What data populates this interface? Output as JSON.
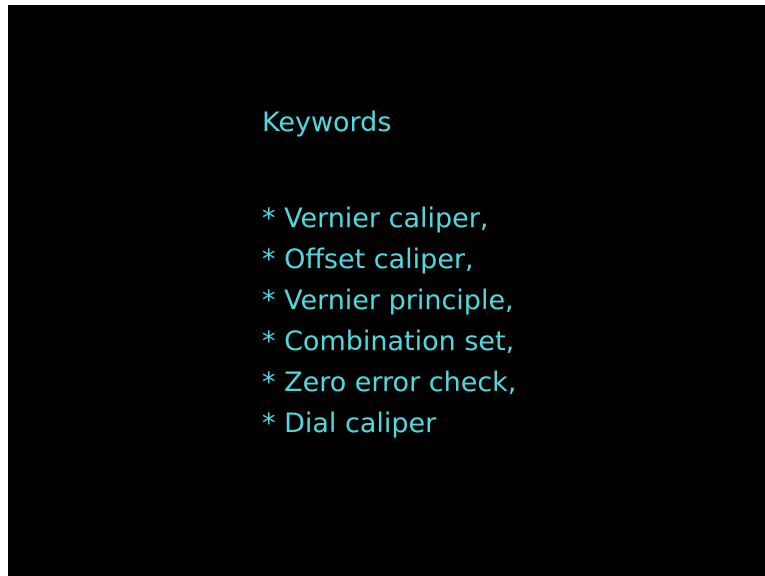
{
  "slide": {
    "title": "Keywords",
    "keywords": [
      "* Vernier caliper,",
      "* Offset caliper,",
      "* Vernier principle,",
      "* Combination set,",
      "* Zero error check,",
      "* Dial caliper"
    ],
    "colors": {
      "background": "#000000",
      "text": "#4fd8de",
      "frame": "#ffffff"
    }
  }
}
